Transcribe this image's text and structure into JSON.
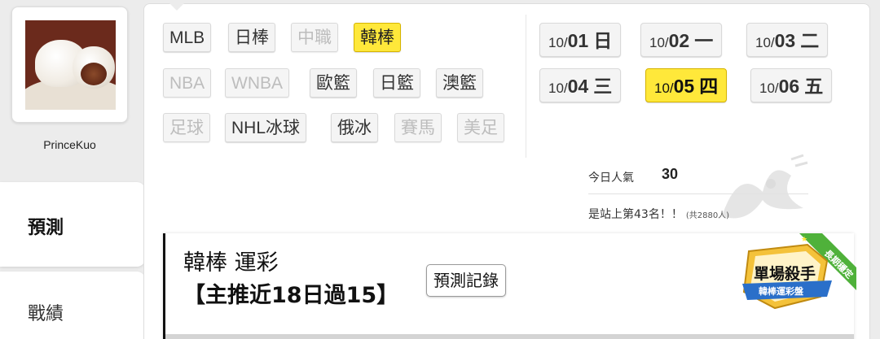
{
  "profile": {
    "username": "PrinceKuo",
    "avatar_icon": "steamed-bun-photo"
  },
  "side_nav": {
    "items": [
      {
        "label": "預測",
        "active": true
      },
      {
        "label": "戰績",
        "active": false
      }
    ]
  },
  "leagues": [
    {
      "label": "MLB",
      "state": "normal"
    },
    {
      "label": "日棒",
      "state": "normal"
    },
    {
      "label": "中職",
      "state": "disabled"
    },
    {
      "label": "韓棒",
      "state": "active"
    },
    {
      "label": "NBA",
      "state": "disabled"
    },
    {
      "label": "WNBA",
      "state": "disabled"
    },
    {
      "label": "歐籃",
      "state": "normal"
    },
    {
      "label": "日籃",
      "state": "normal"
    },
    {
      "label": "澳籃",
      "state": "normal"
    },
    {
      "label": "足球",
      "state": "disabled"
    },
    {
      "label": "NHL冰球",
      "state": "normal"
    },
    {
      "label": "俄冰",
      "state": "normal"
    },
    {
      "label": "賽馬",
      "state": "disabled"
    },
    {
      "label": "美足",
      "state": "disabled"
    }
  ],
  "dates": [
    {
      "month": "10/",
      "day": "01",
      "weekday": "日",
      "active": false
    },
    {
      "month": "10/",
      "day": "02",
      "weekday": "一",
      "active": false
    },
    {
      "month": "10/",
      "day": "03",
      "weekday": "二",
      "active": false
    },
    {
      "month": "10/",
      "day": "04",
      "weekday": "三",
      "active": false
    },
    {
      "month": "10/",
      "day": "05",
      "weekday": "四",
      "active": true
    },
    {
      "month": "10/",
      "day": "06",
      "weekday": "五",
      "active": false
    }
  ],
  "popularity": {
    "label": "今日人氣",
    "value": "30",
    "rank_text": "是站上第43名！！",
    "rank_sub": "(共2880人)"
  },
  "article": {
    "title": "韓棒 運彩",
    "subtitle": "【主推近18日過15】",
    "history_button": "預測記錄"
  },
  "badge": {
    "title": "單場殺手",
    "subtitle": "韓棒運彩盤",
    "ribbon": "長期穩定"
  },
  "colors": {
    "active_yellow": "#ffe83a",
    "background": "#ececec",
    "badge_blue": "#2a6fc9",
    "ribbon_green": "#4fb13a"
  }
}
